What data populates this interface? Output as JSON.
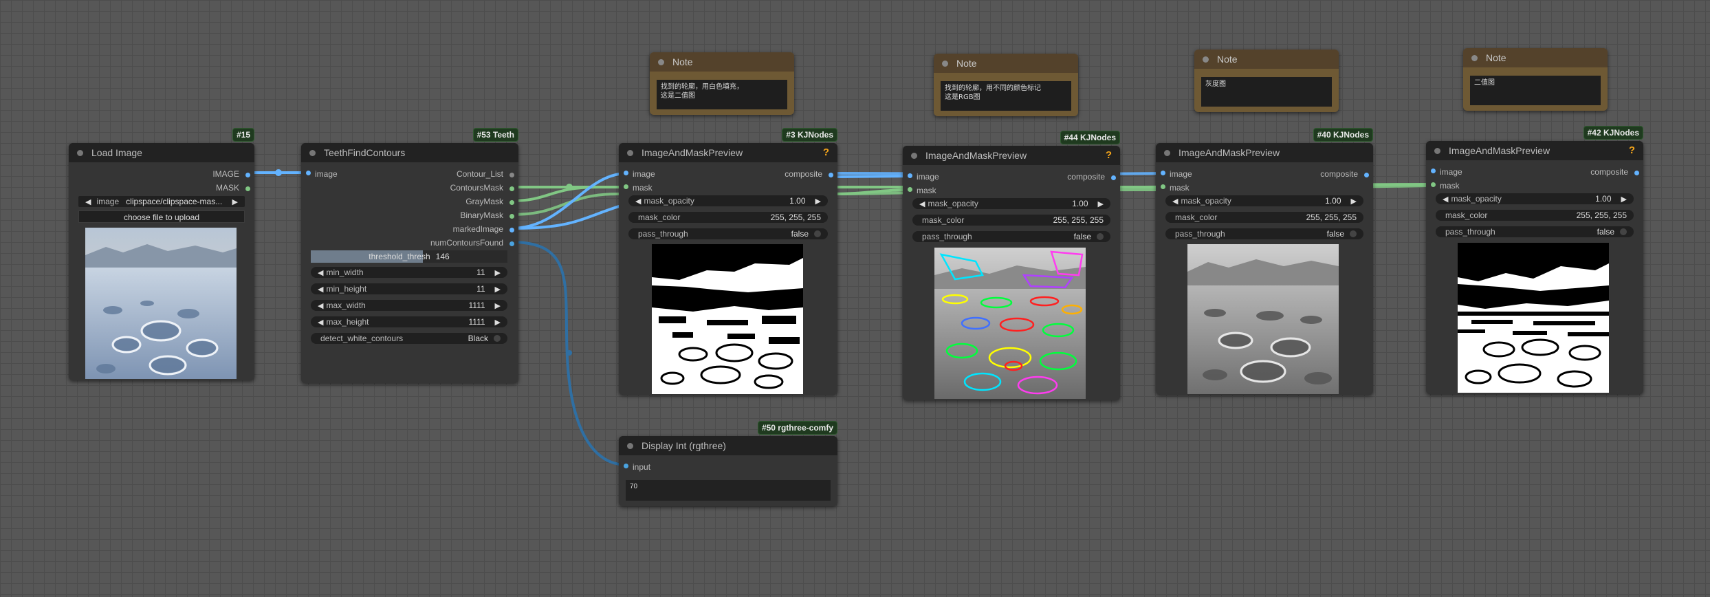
{
  "nodes": {
    "load_image": {
      "title": "Load Image",
      "badge": "#15",
      "outputs": [
        "IMAGE",
        "MASK"
      ],
      "image_widget": {
        "label": "image",
        "value": "clipspace/clipspace-mas..."
      },
      "upload_button": "choose file to upload"
    },
    "find_contours": {
      "title": "TeethFindContours",
      "badge": "#53 Teeth",
      "inputs": [
        "image"
      ],
      "outputs": [
        "Contour_List",
        "ContoursMask",
        "GrayMask",
        "BinaryMask",
        "markedImage",
        "numContoursFound"
      ],
      "threshold": {
        "label": "threshold_thresh",
        "value": "146",
        "fill": 0.57
      },
      "widgets": [
        {
          "label": "min_width",
          "value": "11"
        },
        {
          "label": "min_height",
          "value": "11"
        },
        {
          "label": "max_width",
          "value": "1111"
        },
        {
          "label": "max_height",
          "value": "1111"
        }
      ],
      "detect": {
        "label": "detect_white_contours",
        "value": "Black"
      }
    },
    "preview3": {
      "title": "ImageAndMaskPreview",
      "badge": "#3 KJNodes",
      "inputs": [
        "image",
        "mask"
      ],
      "outputs": [
        "composite"
      ],
      "mask_opacity": {
        "label": "mask_opacity",
        "value": "1.00"
      },
      "mask_color": {
        "label": "mask_color",
        "value": "255, 255, 255"
      },
      "pass_through": {
        "label": "pass_through",
        "value": "false"
      }
    },
    "preview44": {
      "title": "ImageAndMaskPreview",
      "badge": "#44 KJNodes",
      "inputs": [
        "image",
        "mask"
      ],
      "outputs": [
        "composite"
      ],
      "mask_opacity": {
        "label": "mask_opacity",
        "value": "1.00"
      },
      "mask_color": {
        "label": "mask_color",
        "value": "255, 255, 255"
      },
      "pass_through": {
        "label": "pass_through",
        "value": "false"
      }
    },
    "preview40": {
      "title": "ImageAndMaskPreview",
      "badge": "#40 KJNodes",
      "inputs": [
        "image",
        "mask"
      ],
      "outputs": [
        "composite"
      ],
      "mask_opacity": {
        "label": "mask_opacity",
        "value": "1.00"
      },
      "mask_color": {
        "label": "mask_color",
        "value": "255, 255, 255"
      },
      "pass_through": {
        "label": "pass_through",
        "value": "false"
      }
    },
    "preview42": {
      "title": "ImageAndMaskPreview",
      "badge": "#42 KJNodes",
      "inputs": [
        "image",
        "mask"
      ],
      "outputs": [
        "composite"
      ],
      "mask_opacity": {
        "label": "mask_opacity",
        "value": "1.00"
      },
      "mask_color": {
        "label": "mask_color",
        "value": "255, 255, 255"
      },
      "pass_through": {
        "label": "pass_through",
        "value": "false"
      }
    },
    "display_int": {
      "title": "Display Int (rgthree)",
      "badge": "#50 rgthree-comfy",
      "inputs": [
        "input"
      ],
      "value": "70"
    }
  },
  "notes": [
    {
      "title": "Note",
      "text": "找到的轮廓，用白色填充，\n这是二值图"
    },
    {
      "title": "Note",
      "text": "找到的轮廓，用不同的颜色标记\n这是RGB图"
    },
    {
      "title": "Note",
      "text": "灰度图"
    },
    {
      "title": "Note",
      "text": "二值图"
    }
  ],
  "colors": {
    "canvas": "#575757",
    "node_body": "#353535",
    "node_header": "#222222",
    "image_wire": "#63b3ff",
    "mask_wire": "#81c784",
    "int_wire": "#2f6fa3",
    "badge_bg": "#1f3a1f",
    "help_icon": "#f3a41a",
    "note_body": "#6e5934"
  }
}
